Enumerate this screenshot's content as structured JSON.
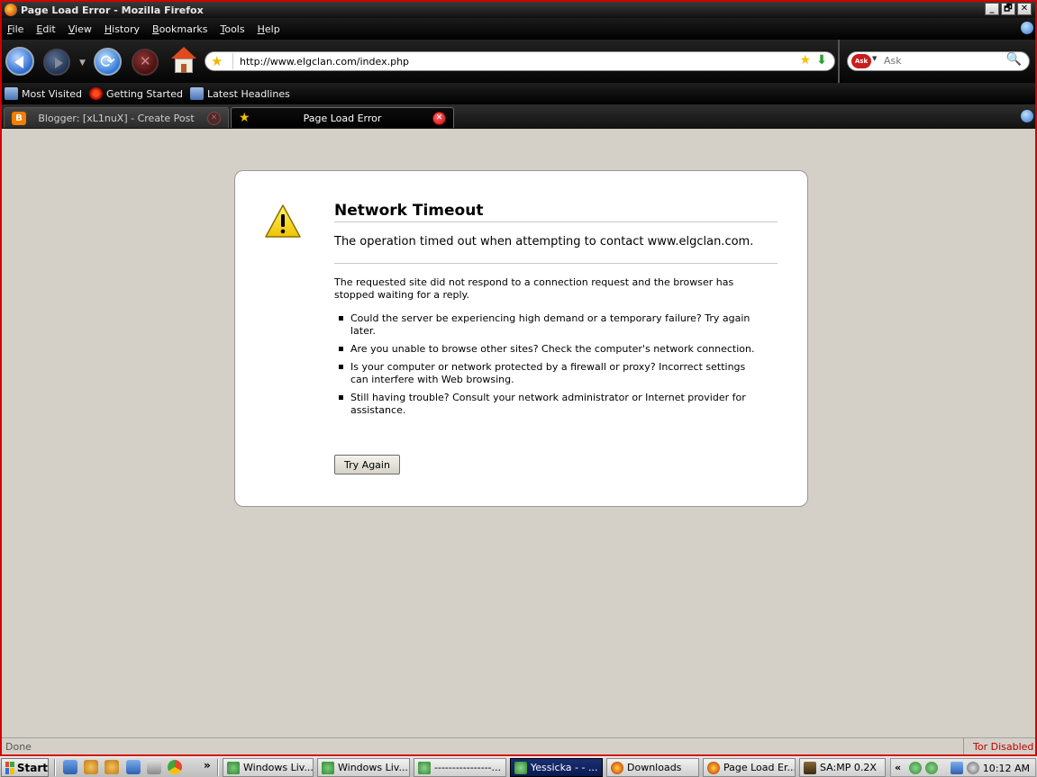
{
  "window": {
    "title": "Page Load Error - Mozilla Firefox",
    "controls": {
      "minimize": "_",
      "restore": "🗗",
      "close": "✕"
    }
  },
  "menu": [
    "File",
    "Edit",
    "View",
    "History",
    "Bookmarks",
    "Tools",
    "Help"
  ],
  "navbar": {
    "url": "http://www.elgclan.com/index.php",
    "search_placeholder": "Ask",
    "search_engine": "Ask",
    "icons": [
      "back-icon",
      "forward-icon",
      "reload-icon",
      "stop-icon",
      "home-icon",
      "star-icon",
      "go-icon",
      "magnifier-icon"
    ]
  },
  "bookmarks": [
    "Most Visited",
    "Getting Started",
    "Latest Headlines"
  ],
  "tabs": [
    {
      "label": "Blogger: [xL1nuX] - Create Post",
      "active": false
    },
    {
      "label": "Page Load Error",
      "active": true
    }
  ],
  "error": {
    "title": "Network Timeout",
    "short": "The operation timed out when attempting to contact www.elgclan.com.",
    "long": "The requested site did not respond to a connection request and the browser has stopped waiting for a reply.",
    "bullets": [
      "Could the server be experiencing high demand or a temporary failure? Try again later.",
      "Are you unable to browse other sites? Check the computer's network connection.",
      "Is your computer or network protected by a firewall or proxy? Incorrect settings can interfere with Web browsing.",
      "Still having trouble? Consult your network administrator or Internet provider for assistance."
    ],
    "button": "Try Again"
  },
  "status": {
    "left": "Done",
    "right": "Tor Disabled"
  },
  "taskbar": {
    "start": "Start",
    "overflow": "»",
    "buttons": [
      {
        "label": "Windows Liv...",
        "active": false
      },
      {
        "label": "Windows Liv...",
        "active": false
      },
      {
        "label": "----------------...",
        "active": false
      },
      {
        "label": "Yessicka - - ...",
        "active": true
      },
      {
        "label": "Downloads",
        "active": false
      },
      {
        "label": "Page Load Er...",
        "active": false
      },
      {
        "label": "SA:MP 0.2X",
        "active": false
      }
    ],
    "tray_chevron": "«",
    "clock": "10:12 AM"
  },
  "colors": {
    "accent_red": "#d40000",
    "toolbar_dark": "#111111",
    "content_bg": "#d4d0c8",
    "tor_disabled": "#c00000"
  }
}
